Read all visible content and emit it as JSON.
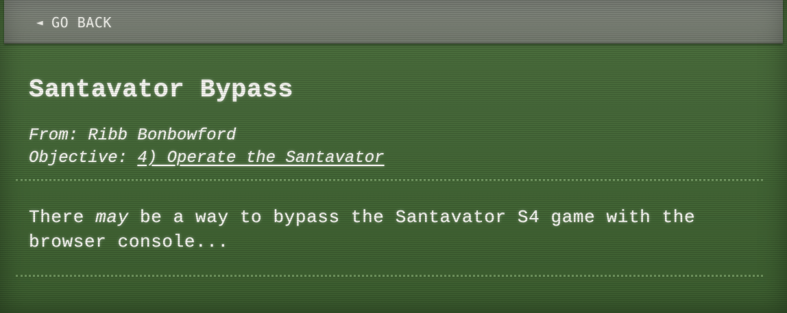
{
  "nav": {
    "back_icon": "◄",
    "back_label": "GO BACK"
  },
  "hint": {
    "title": "Santavator Bypass",
    "from_label": "From:",
    "from_name": "Ribb Bonbowford",
    "objective_label": "Objective:",
    "objective_link": "4) Operate the Santavator",
    "message_part1": "There ",
    "message_emphasis": "may",
    "message_part2": " be a way to bypass the Santavator S4 game with the browser console..."
  },
  "colors": {
    "background": "#47693a",
    "top_bar": "#7c8277",
    "text": "#f3f3ee"
  }
}
